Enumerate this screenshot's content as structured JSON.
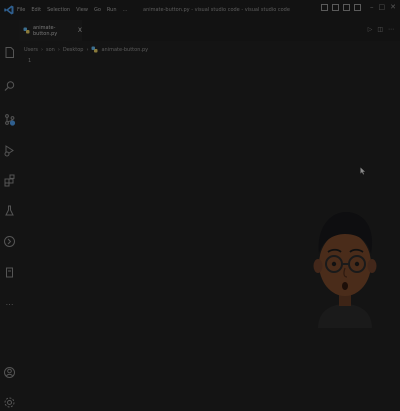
{
  "titlebar": {
    "menu": [
      "File",
      "Edit",
      "Selection",
      "View",
      "Go",
      "Run",
      "…"
    ],
    "title": "animate-button.py - visual studio code - visual studio code"
  },
  "activity_bar": {
    "icons": [
      "explorer-icon",
      "search-icon",
      "source-control-icon",
      "run-debug-icon",
      "extensions-icon",
      "testing-icon",
      "remote-icon",
      "notebook-icon",
      "more-icon",
      "account-icon",
      "settings-icon"
    ]
  },
  "editor": {
    "tab": {
      "label": "animate-button.py",
      "close": "X"
    },
    "breadcrumb": [
      "Users",
      "son",
      "Desktop",
      "animate-button.py"
    ],
    "line_numbers": [
      "1"
    ]
  },
  "colors": {
    "background": "#141414",
    "accent": "#2f5f8f",
    "python_icon": "#3b6e8f"
  }
}
